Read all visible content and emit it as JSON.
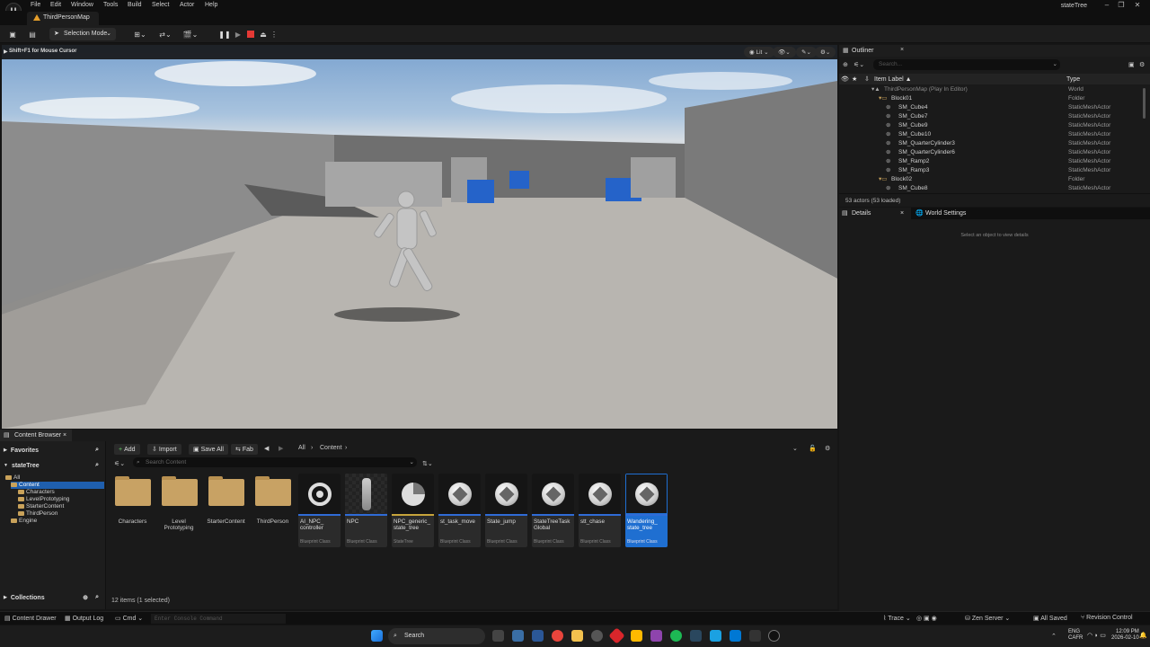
{
  "menubar": {
    "items": [
      "File",
      "Edit",
      "Window",
      "Tools",
      "Build",
      "Select",
      "Actor",
      "Help"
    ],
    "project": "stateTree"
  },
  "tab": {
    "label": "ThirdPersonMap"
  },
  "toolbar": {
    "mode": "Selection Mode"
  },
  "viewport": {
    "hint": "Shift+F1 for Mouse Cursor",
    "lit": "Lit"
  },
  "content_browser": {
    "tab": "Content Browser",
    "favorites": "Favorites",
    "project": "stateTree",
    "tree": [
      "All",
      "Content",
      "Characters",
      "LevelPrototyping",
      "StarterContent",
      "ThirdPerson",
      "Engine"
    ],
    "collections": "Collections",
    "add": "Add",
    "import": "Import",
    "saveall": "Save All",
    "fab": "Fab",
    "path": [
      "All",
      "Content"
    ],
    "search_placeholder": "Search Content",
    "folders": [
      "Characters",
      "Level Prototyping",
      "StarterContent",
      "ThirdPerson"
    ],
    "assets": [
      {
        "name": "AI_NPC_ controller",
        "type": "Blueprint Class",
        "color": "#2f6bd6"
      },
      {
        "name": "NPC",
        "type": "Blueprint Class",
        "color": "#2f6bd6"
      },
      {
        "name": "NPC_generic_ state_tree",
        "type": "StateTree",
        "color": "#c7a43a"
      },
      {
        "name": "st_task_move",
        "type": "Blueprint Class",
        "color": "#2f6bd6"
      },
      {
        "name": "State_jump",
        "type": "Blueprint Class",
        "color": "#2f6bd6"
      },
      {
        "name": "StateTreeTask Global",
        "type": "Blueprint Class",
        "color": "#2f6bd6"
      },
      {
        "name": "stt_chase",
        "type": "Blueprint Class",
        "color": "#2f6bd6"
      },
      {
        "name": "Wandering_ state_tree",
        "type": "Blueprint Class",
        "color": "#2f6bd6"
      }
    ],
    "status": "12 items (1 selected)"
  },
  "outliner": {
    "title": "Outliner",
    "search_placeholder": "Search...",
    "col_label": "Item Label ▲",
    "col_type": "Type",
    "rows": [
      {
        "label": "ThirdPersonMap (Play In Editor)",
        "type": "World"
      },
      {
        "label": "Block01",
        "type": "Folder"
      },
      {
        "label": "SM_Cube4",
        "type": "StaticMeshActor"
      },
      {
        "label": "SM_Cube7",
        "type": "StaticMeshActor"
      },
      {
        "label": "SM_Cube9",
        "type": "StaticMeshActor"
      },
      {
        "label": "SM_Cube10",
        "type": "StaticMeshActor"
      },
      {
        "label": "SM_QuarterCylinder3",
        "type": "StaticMeshActor"
      },
      {
        "label": "SM_QuarterCylinder6",
        "type": "StaticMeshActor"
      },
      {
        "label": "SM_Ramp2",
        "type": "StaticMeshActor"
      },
      {
        "label": "SM_Ramp3",
        "type": "StaticMeshActor"
      },
      {
        "label": "Block02",
        "type": "Folder"
      },
      {
        "label": "SM_Cube8",
        "type": "StaticMeshActor"
      }
    ],
    "footer": "53 actors (53 loaded)"
  },
  "details": {
    "tab1": "Details",
    "tab2": "World Settings",
    "empty": "Select an object to view details"
  },
  "statusbar": {
    "drawer": "Content Drawer",
    "outputlog": "Output Log",
    "cmd": "Cmd",
    "console_placeholder": "Enter Console Command",
    "trace": "Trace",
    "zen": "Zen Server",
    "saved": "All Saved",
    "revision": "Revision Control"
  },
  "taskbar": {
    "search": "Search",
    "lang": "ENG",
    "region": "CAFR",
    "time": "12:09 PM",
    "date": "2026-02-10"
  }
}
